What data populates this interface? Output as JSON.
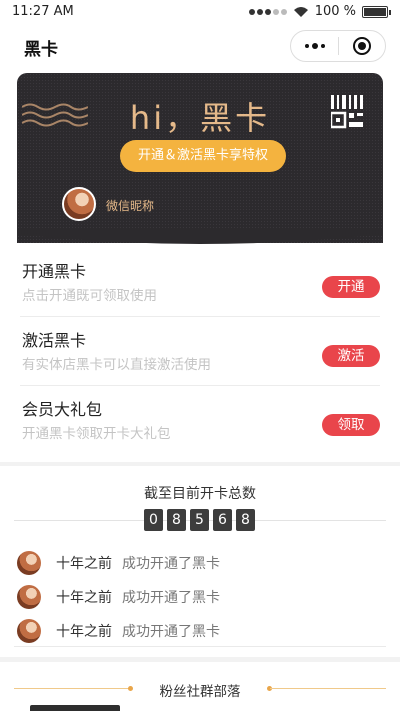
{
  "status_bar": {
    "time": "11:27 AM",
    "battery": "100 %"
  },
  "nav": {
    "title": "黑卡"
  },
  "card": {
    "greeting": "hi，黑卡",
    "cta": "开通＆激活黑卡享特权",
    "nickname": "微信昵称",
    "icons": [
      "wave-icon",
      "qr-code-icon",
      "avatar"
    ]
  },
  "actions": [
    {
      "title": "开通黑卡",
      "subtitle": "点击开通既可领取使用",
      "button": "开通"
    },
    {
      "title": "激活黑卡",
      "subtitle": "有实体店黑卡可以直接激活使用",
      "button": "激活"
    },
    {
      "title": "会员大礼包",
      "subtitle": "开通黑卡领取开卡大礼包",
      "button": "领取"
    }
  ],
  "counter": {
    "label": "截至目前开卡总数",
    "digits": [
      "0",
      "8",
      "5",
      "6",
      "8"
    ]
  },
  "feed": [
    {
      "when": "十年之前",
      "what": "成功开通了黑卡"
    },
    {
      "when": "十年之前",
      "what": "成功开通了黑卡"
    },
    {
      "when": "十年之前",
      "what": "成功开通了黑卡"
    }
  ],
  "fans": {
    "label": "粉丝社群部落"
  },
  "colors": {
    "accent_red": "#e9454b",
    "gold": "#e5b98a",
    "cta_yellow": "#f4b33f",
    "card_dark": "#2c2a2d"
  }
}
